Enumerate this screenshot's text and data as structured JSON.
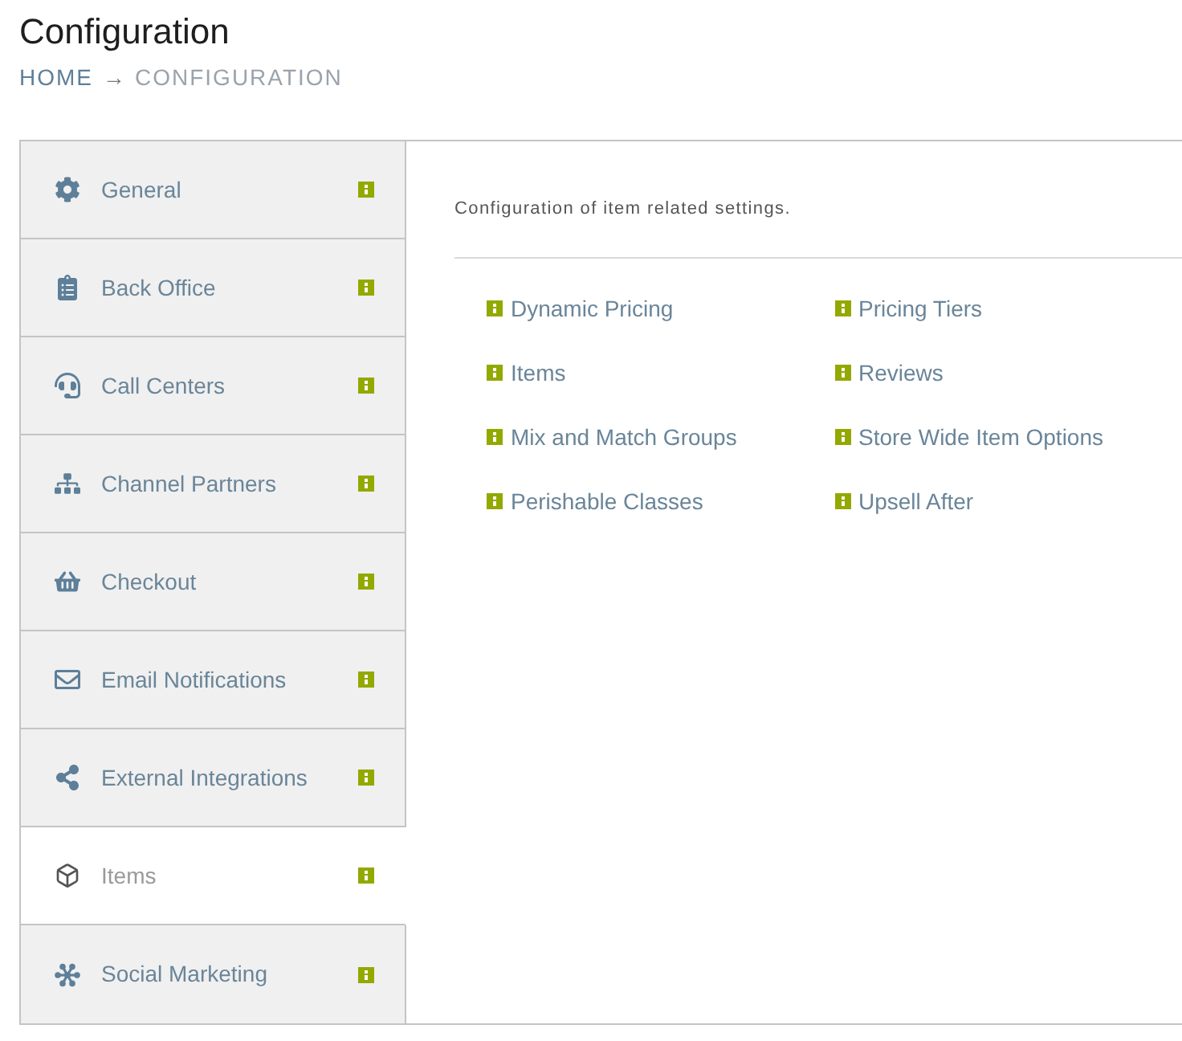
{
  "page": {
    "title": "Configuration"
  },
  "breadcrumb": {
    "separator": "→",
    "items": [
      {
        "label": "HOME",
        "kind": "link"
      },
      {
        "label": "CONFIGURATION",
        "kind": "current"
      }
    ]
  },
  "sidebar": {
    "items": [
      {
        "label": "General",
        "selected": false
      },
      {
        "label": "Back Office",
        "selected": false
      },
      {
        "label": "Call Centers",
        "selected": false
      },
      {
        "label": "Channel Partners",
        "selected": false
      },
      {
        "label": "Checkout",
        "selected": false
      },
      {
        "label": "Email Notifications",
        "selected": false
      },
      {
        "label": "External Integrations",
        "selected": false
      },
      {
        "label": "Items",
        "selected": true
      },
      {
        "label": "Social Marketing",
        "selected": false
      }
    ]
  },
  "content": {
    "description": "Configuration of item related settings.",
    "columns": [
      {
        "links": [
          "Dynamic Pricing",
          "Items",
          "Mix and Match Groups",
          "Perishable Classes"
        ]
      },
      {
        "links": [
          "Pricing Tiers",
          "Reviews",
          "Store Wide Item Options",
          "Upsell After"
        ]
      }
    ]
  }
}
